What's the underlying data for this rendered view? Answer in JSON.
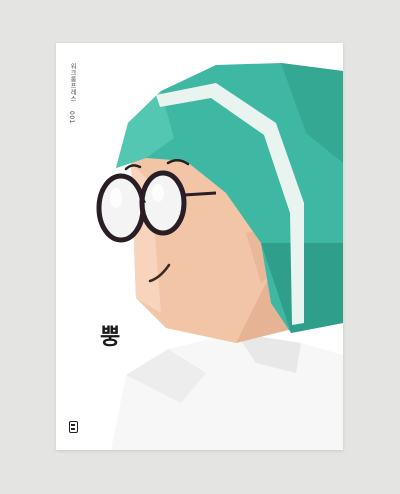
{
  "poster": {
    "publisher": "워크룸프레스",
    "issue": "001",
    "title": "뿡"
  },
  "colors": {
    "background": "#e4e4e2",
    "helmet": "#3fb8a3",
    "skin": "#f2c5a6",
    "body": "#ffffff"
  }
}
